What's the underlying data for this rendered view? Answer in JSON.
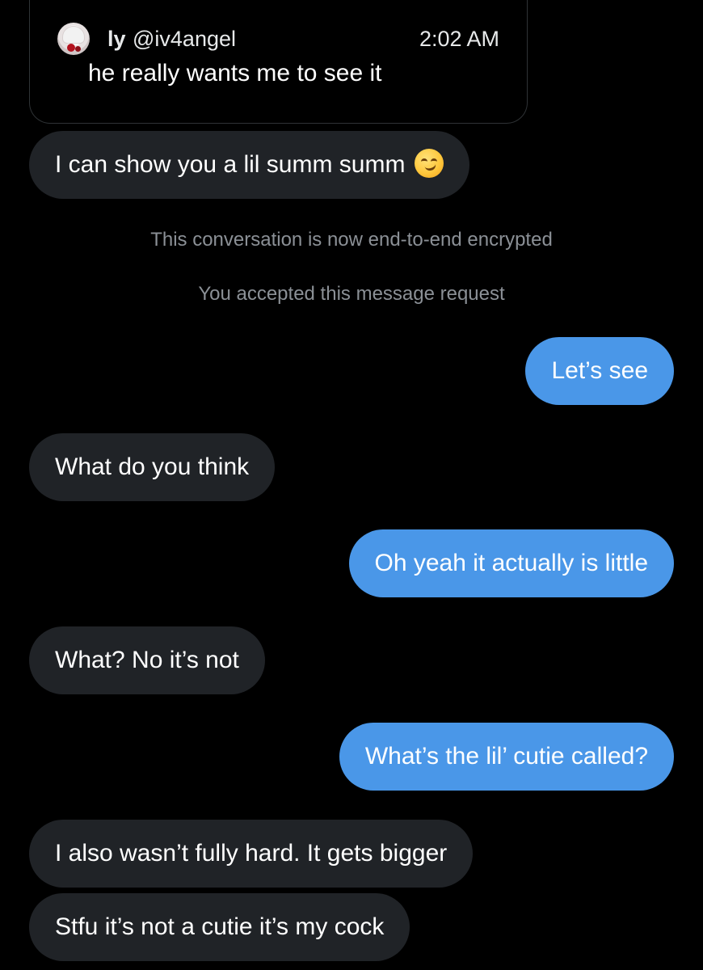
{
  "quoted_post": {
    "display_name": "ly",
    "handle": "@iv4angel",
    "time": "2:02 AM",
    "text": "he really wants me to see it"
  },
  "messages": [
    {
      "direction": "received",
      "text": "I can show you a lil summ summ",
      "emoji": "smirking-face"
    },
    {
      "direction": "sent",
      "text": "Let’s see"
    },
    {
      "direction": "received",
      "text": "What do you think"
    },
    {
      "direction": "sent",
      "text": "Oh yeah it actually is little"
    },
    {
      "direction": "received",
      "text": "What? No it’s not"
    },
    {
      "direction": "sent",
      "text": "What’s the lil’ cutie called?"
    },
    {
      "direction": "received",
      "text": "I also wasn’t fully hard. It gets bigger"
    },
    {
      "direction": "received",
      "text": "Stfu it’s not a cutie it’s my cock"
    }
  ],
  "system_notices": {
    "encrypted": "This conversation is now end-to-end encrypted",
    "accepted": "You accepted this message request"
  },
  "colors": {
    "background": "#000000",
    "received_bubble": "#202327",
    "sent_bubble": "#4a97e8",
    "system_text": "#8b9096"
  }
}
